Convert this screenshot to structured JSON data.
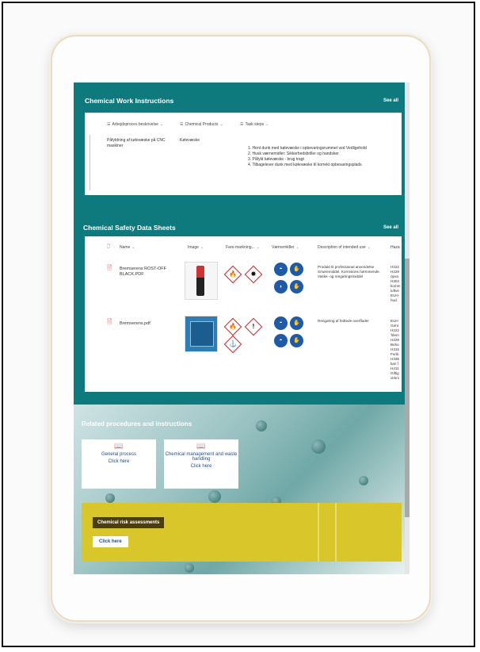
{
  "cwi": {
    "title": "Chemical Work Instructions",
    "see_all": "See all",
    "columns": [
      "Arbejdsproces beskrivelse",
      "Chemical Products",
      "Task steps"
    ],
    "row": {
      "process": "Påfyldning af kølevæske på CNC maskiner",
      "product": "Kølevæske",
      "steps": [
        "1. Hent dunk med kølevæske i opbevaringsrummet ved Vedligehold",
        "2. Husk værnemidler: Sikkerhedsbriller og handsker",
        "3. Påfyld kølevæske - brug tragt",
        "4. Tilbagelever dunk med kølevæske til korrekt opbevaringsplads"
      ]
    }
  },
  "csds": {
    "title": "Chemical Safety Data Sheets",
    "see_all": "See all",
    "columns": [
      "Name",
      "Image",
      "Fare-markning...",
      "Værnemidler",
      "Description of intended use",
      "Haza"
    ],
    "rows": [
      {
        "name": "Bremserens ROST-OFF BLACK.PDF",
        "description": "Produkt til professional anvendelse Smøremiddel. Korrosions hæmmende. Vaske- og rengøringsmiddel",
        "hazard": "H222 H229 opva H304 komm luftve EUH- hud.",
        "ghs": [
          "flame-pictogram",
          "health-hazard-pictogram"
        ],
        "ppe": [
          "mask-icon",
          "glove-icon",
          "shield-icon",
          "hand-wash-icon"
        ]
      },
      {
        "name": "Bremserens.pdf",
        "description": "Rengøring af fedtede overflader",
        "hazard": "EUH Gent H222 'ldem H229 Beho H315 Foråi H336 kan f H411 Giftig virkni",
        "ghs": [
          "flame-pictogram",
          "exclamation-pictogram",
          "environment-pictogram"
        ],
        "ppe": [
          "goggles-icon",
          "glove-icon",
          "mask-icon",
          "hand-icon"
        ]
      }
    ]
  },
  "related": {
    "title": "Related procedures and instructions",
    "cards": [
      {
        "title": "General process",
        "link": "Click here"
      },
      {
        "title": "Chemical management and waste handling",
        "link": "Click here"
      }
    ]
  },
  "risk": {
    "label": "Chemical risk assessments",
    "button": "Click here"
  }
}
